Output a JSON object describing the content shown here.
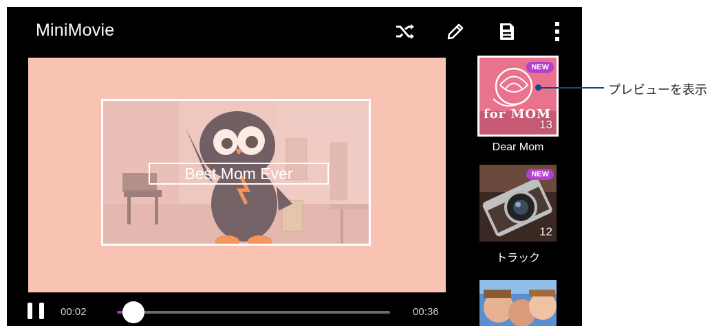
{
  "app": {
    "title": "MiniMovie"
  },
  "toolbar": {
    "icons": [
      "shuffle-icon",
      "edit-pencil-icon",
      "save-icon",
      "more-vert-icon"
    ]
  },
  "preview": {
    "caption": "Best Mom Ever",
    "background_color": "#f9c3b4"
  },
  "player": {
    "current_time": "00:02",
    "total_time": "00:36",
    "progress": 0.06,
    "accent": "#a52bd1"
  },
  "themes": [
    {
      "name": "Dear Mom",
      "badge": "NEW",
      "count": "13",
      "thumb_text": "for MOM",
      "selected": true
    },
    {
      "name": "トラック",
      "badge": "NEW",
      "count": "12",
      "selected": false
    },
    {
      "name": "",
      "badge": "",
      "count": "",
      "selected": false
    }
  ],
  "annotation": {
    "text": "プレビューを表示",
    "color": "#0b4a85"
  }
}
